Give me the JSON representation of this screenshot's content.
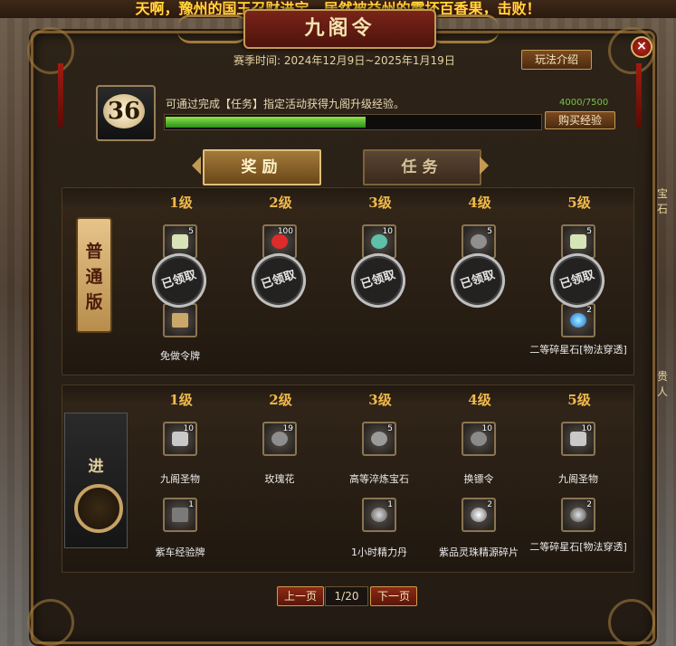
{
  "background": {
    "ticker": "天啊，豫州的国王召财进宝，居然被益州的霹坏百香果，击败！",
    "side_label_right_1": "宝石",
    "side_label_right_2": "贵人"
  },
  "panel": {
    "title": "九阁令",
    "close_icon": "×",
    "season_label": "赛季时间:",
    "season_range": "2024年12月9日~2025年1月19日",
    "rules_button": "玩法介绍"
  },
  "level": {
    "value": "36",
    "description": "可通过完成【任务】指定活动获得九阁升级经验。",
    "exp_text": "4000/7500",
    "exp_fraction": 0.533,
    "buy_button": "购买经验"
  },
  "tabs": [
    {
      "label": "奖励",
      "active": true
    },
    {
      "label": "任务",
      "active": false
    }
  ],
  "tracks": {
    "normal": {
      "badge": "普通版",
      "claimed_label": "已领取",
      "levels": [
        "1级",
        "2级",
        "3级",
        "4级",
        "5级"
      ],
      "row1": [
        {
          "qty": "5",
          "icon": "scroll-icon"
        },
        {
          "qty": "100",
          "icon": "red-potion-icon"
        },
        {
          "qty": "10",
          "icon": "jade-icon"
        },
        {
          "qty": "5",
          "icon": "token-icon"
        },
        {
          "qty": "5",
          "icon": "scroll-icon"
        }
      ],
      "row2": [
        {
          "qty": "",
          "icon": "fan-icon",
          "name": "免做令牌"
        },
        {
          "qty": "2",
          "icon": "star-stone-icon",
          "name": "二等碎星石[物法穿透]"
        }
      ]
    },
    "advanced": {
      "badge": "进",
      "levels": [
        "1级",
        "2级",
        "3级",
        "4级",
        "5级"
      ],
      "row1": [
        {
          "qty": "10",
          "name": "九阁圣物",
          "icon": "scroll-icon"
        },
        {
          "qty": "19",
          "name": "玫瑰花",
          "icon": "rose-icon"
        },
        {
          "qty": "5",
          "name": "高等淬炼宝石",
          "icon": "stone-icon"
        },
        {
          "qty": "10",
          "name": "换镖令",
          "icon": "token-icon"
        },
        {
          "qty": "10",
          "name": "九阁圣物",
          "icon": "scroll-icon"
        }
      ],
      "row2": [
        {
          "qty": "1",
          "name": "紫车经验牌",
          "icon": "plaque-icon"
        },
        {
          "qty": "1",
          "name": "1小时精力丹",
          "icon": "pill-icon"
        },
        {
          "qty": "2",
          "name": "紫品灵珠精源碎片",
          "icon": "orb-icon"
        },
        {
          "qty": "2",
          "name": "二等碎星石[物法穿透]",
          "icon": "star-stone-icon"
        }
      ]
    }
  },
  "pager": {
    "prev": "上一页",
    "page": "1/20",
    "next": "下一页"
  }
}
